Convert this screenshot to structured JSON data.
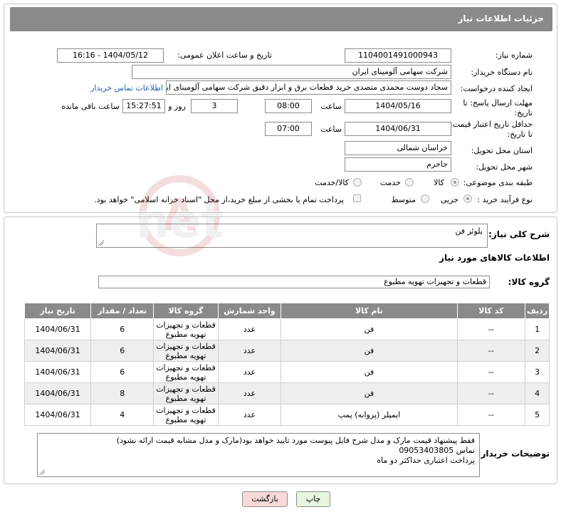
{
  "header": {
    "title": "جزئیات اطلاعات نیاز"
  },
  "form": {
    "need_number_label": "شماره نیاز:",
    "need_number": "1104001491000943",
    "announce_label": "تاریخ و ساعت اعلان عمومی:",
    "announce_value": "1404/05/12 - 16:16",
    "buyer_org_label": "نام دستگاه خریدار:",
    "buyer_org": "شرکت سهامی آلومینای ایران",
    "creator_label": "ایجاد کننده درخواست:",
    "creator": "سجاد دوست محمدی متصدی خرید قطعات برق و ابزار دقیق شرکت سهامی آلومینای ایران",
    "contact_link": "اطلاعات تماس خریدار",
    "reply_deadline_label_1": "مهلت ارسال پاسخ: تا",
    "reply_deadline_label_2": "تاریخ:",
    "reply_date": "1404/05/16",
    "time_label": "ساعت",
    "reply_time": "08:00",
    "days_value": "3",
    "days_label": "روز و",
    "remaining_time": "15:27:51",
    "remaining_label": "ساعت باقی مانده",
    "price_validity_label_1": "حداقل تاریخ اعتبار قیمت:",
    "price_validity_label_2": "تا تاریخ:",
    "validity_date": "1404/06/31",
    "validity_time": "07:00",
    "province_label": "استان محل تحویل:",
    "province": "خراسان شمالی",
    "city_label": "شهر محل تحویل:",
    "city": "جاجرم",
    "category_label": "طبقه بندی موضوعی:",
    "category_options": [
      "کالا",
      "خدمت",
      "کالا/خدمت"
    ],
    "process_label": "نوع فرآیند خرید :",
    "process_options": [
      "جزیی",
      "متوسط"
    ],
    "payment_note": "پرداخت تمام یا بخشی از مبلغ خرید،از محل \"اسناد خزانه اسلامی\" خواهد بود."
  },
  "details": {
    "summary_label": "شرح کلی نیاز:",
    "summary": "بلوئر فن",
    "goods_info_title": "اطلاعات کالاهای مورد نیاز",
    "goods_group_label": "گروه کالا:",
    "goods_group": "قطعات و تجهیزات تهویه مطبوع"
  },
  "table": {
    "headers": [
      "ردیف",
      "کد کالا",
      "نام کالا",
      "واحد شمارش",
      "گروه کالا",
      "تعداد / مقدار",
      "تاریخ نیاز"
    ],
    "rows": [
      [
        "1",
        "--",
        "فن",
        "عدد",
        "قطعات و تجهیزات تهویه مطبوع",
        "6",
        "1404/06/31"
      ],
      [
        "2",
        "--",
        "فن",
        "عدد",
        "قطعات و تجهیزات تهویه مطبوع",
        "6",
        "1404/06/31"
      ],
      [
        "3",
        "--",
        "فن",
        "عدد",
        "قطعات و تجهیزات تهویه مطبوع",
        "6",
        "1404/06/31"
      ],
      [
        "4",
        "--",
        "فن",
        "عدد",
        "قطعات و تجهیزات تهویه مطبوع",
        "8",
        "1404/06/31"
      ],
      [
        "5",
        "--",
        "ایمپلر (پروانه) پمپ",
        "عدد",
        "قطعات و تجهیزات تهویه مطبوع",
        "4",
        "1404/06/31"
      ]
    ]
  },
  "notes": {
    "label": "توضیحات خریدار:",
    "line1": "فقط پیشنهاد قیمت مارک و مدل شرح فایل پیوست مورد تایید خواهد بود(مارک و مدل مشابه قیمت ارائه نشود)",
    "line2": "تماس 09053403805",
    "line3": "پرداخت اعتباری حداکثر دو ماه"
  },
  "buttons": {
    "print": "چاپ",
    "back": "بازگشت"
  },
  "watermark": {
    "text": "AriaTender.net"
  }
}
